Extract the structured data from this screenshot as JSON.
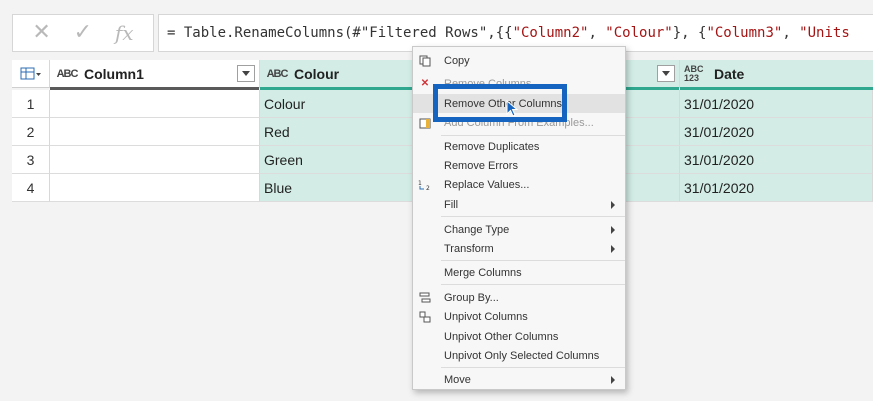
{
  "formula_bar": {
    "cancel_icon": "close-icon",
    "confirm_icon": "check-icon",
    "fx_label": "fx",
    "prefix": "= Table.RenameColumns(#\"Filtered Rows\",{{",
    "s1": "\"Column2\"",
    "c1": ", ",
    "s2": "\"Colour\"",
    "c2": "}, {",
    "s3": "\"Column3\"",
    "c3": ", ",
    "s4": "\"Units"
  },
  "grid": {
    "columns": [
      {
        "type": "ABC",
        "name": "Column1"
      },
      {
        "type": "ABC",
        "name": "Colour"
      },
      {
        "type": "123",
        "type_top": "ABC",
        "name": "Date"
      }
    ],
    "rows": [
      {
        "num": "1",
        "col1": "",
        "colour": "Colour",
        "date": "31/01/2020"
      },
      {
        "num": "2",
        "col1": "",
        "colour": "Red",
        "date": "31/01/2020"
      },
      {
        "num": "3",
        "col1": "",
        "colour": "Green",
        "date": "31/01/2020"
      },
      {
        "num": "4",
        "col1": "",
        "colour": "Blue",
        "date": "31/01/2020"
      }
    ]
  },
  "context_menu": {
    "items": [
      {
        "label": "Copy",
        "icon": "copy-icon"
      },
      {
        "label": "Remove Columns",
        "icon": "remove-icon"
      },
      {
        "label": "Remove Other Columns",
        "icon": ""
      },
      {
        "label": "Add Column From Examples...",
        "icon": "add-column-icon"
      },
      {
        "label": "Remove Duplicates",
        "icon": ""
      },
      {
        "label": "Remove Errors",
        "icon": ""
      },
      {
        "label": "Replace Values...",
        "icon": "replace-icon"
      },
      {
        "label": "Fill",
        "icon": ""
      },
      {
        "label": "Change Type",
        "icon": ""
      },
      {
        "label": "Transform",
        "icon": ""
      },
      {
        "label": "Merge Columns",
        "icon": ""
      },
      {
        "label": "Group By...",
        "icon": "group-by-icon"
      },
      {
        "label": "Unpivot Columns",
        "icon": "unpivot-icon"
      },
      {
        "label": "Unpivot Other Columns",
        "icon": ""
      },
      {
        "label": "Unpivot Only Selected Columns",
        "icon": ""
      },
      {
        "label": "Move",
        "icon": ""
      }
    ]
  },
  "colors": {
    "accent_highlight": "#1565c0",
    "selected_column": "#d3ede6",
    "column_bar": "#2fa88f"
  }
}
